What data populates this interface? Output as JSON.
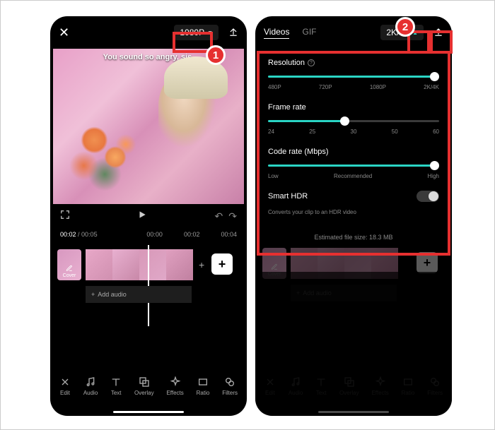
{
  "left_phone": {
    "resolution_dd": "1080P",
    "caption": "You sound so angry, sis.",
    "time_current": "00:02",
    "time_total": "00:05",
    "tick_labels": [
      "00:00",
      "00:02",
      "00:04"
    ],
    "cover_label": "Cover",
    "add_audio": "Add audio",
    "plus": "+",
    "bottom_bar": [
      {
        "label": "Edit"
      },
      {
        "label": "Audio"
      },
      {
        "label": "Text"
      },
      {
        "label": "Overlay"
      },
      {
        "label": "Effects"
      },
      {
        "label": "Ratio"
      },
      {
        "label": "Filters"
      }
    ]
  },
  "right_phone": {
    "tabs": {
      "videos": "Videos",
      "gif": "GIF"
    },
    "resolution_dd": "2K/4K",
    "settings": {
      "resolution": {
        "label": "Resolution",
        "ticks": [
          "480P",
          "720P",
          "1080P",
          "2K/4K"
        ],
        "value_percent": 100
      },
      "frame_rate": {
        "label": "Frame rate",
        "ticks": [
          "24",
          "25",
          "30",
          "50",
          "60"
        ],
        "value_percent": 45
      },
      "code_rate": {
        "label": "Code rate (Mbps)",
        "ticks": [
          "Low",
          "Recommended",
          "High"
        ],
        "value_percent": 100
      },
      "smart_hdr": {
        "label": "Smart HDR",
        "sub": "Converts your clip to an HDR video"
      }
    },
    "estimated": "Estimated file size: 18.3 MB",
    "cover_label": "Cover",
    "add_audio": "Add audio",
    "bottom_bar": [
      {
        "label": "Edit"
      },
      {
        "label": "Audio"
      },
      {
        "label": "Text"
      },
      {
        "label": "Overlay"
      },
      {
        "label": "Effects"
      },
      {
        "label": "Ratio"
      },
      {
        "label": "Filters"
      }
    ]
  },
  "annotations": {
    "badge1": "1",
    "badge2": "2"
  }
}
